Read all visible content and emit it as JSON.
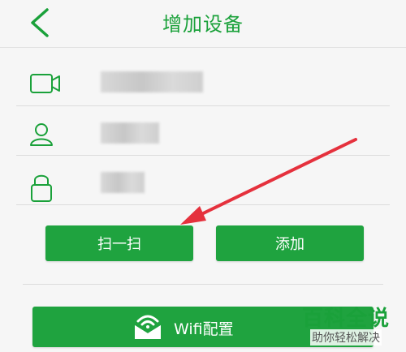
{
  "header": {
    "title": "增加设备",
    "back_icon": "chevron-left-icon"
  },
  "form": {
    "device_icon": "camera-icon",
    "user_icon": "user-icon",
    "password_icon": "lock-icon"
  },
  "actions": {
    "scan_label": "扫一扫",
    "add_label": "添加",
    "wifi_label": "Wifi配置",
    "wifi_icon": "wifi-envelope-icon"
  },
  "watermark": {
    "title": "百科全说",
    "subtitle": "助你轻松解决"
  },
  "colors": {
    "accent": "#1fa33f",
    "annotation_arrow": "#e5313d"
  }
}
